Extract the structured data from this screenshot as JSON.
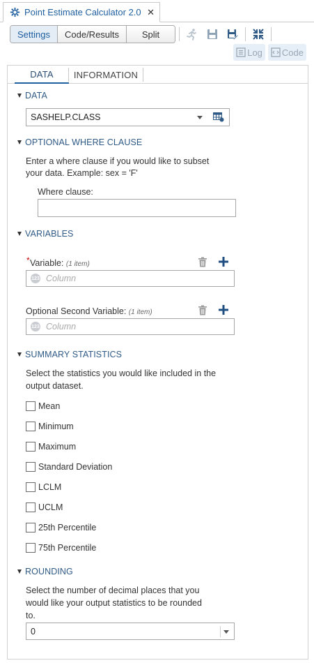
{
  "window": {
    "tab_title": "Point Estimate Calculator 2.0",
    "tab_icon": "gear-cluster-icon",
    "close_glyph": "✕"
  },
  "toolbar": {
    "modes": [
      "Settings",
      "Code/Results",
      "Split"
    ],
    "active_mode": "Settings",
    "icons": [
      "run-icon",
      "save-icon",
      "save-as-icon",
      "collapse-icon"
    ],
    "log_label": "Log",
    "code_label": "Code"
  },
  "subtabs": {
    "items": [
      "DATA",
      "INFORMATION"
    ],
    "active": "DATA"
  },
  "sections": {
    "data": {
      "heading": "DATA",
      "dataset_value": "SASHELP.CLASS"
    },
    "where": {
      "heading": "OPTIONAL WHERE CLAUSE",
      "description_line1": "Enter a where clause if you would like to subset",
      "description_line2": "your data. Example: sex = 'F'",
      "field_label": "Where clause:",
      "field_value": ""
    },
    "variables": {
      "heading": "VARIABLES",
      "required_marker": "*",
      "var1_label": "Variable:",
      "var1_count": "(1 item)",
      "var1_placeholder": "Column",
      "var2_label": "Optional Second Variable:",
      "var2_count": "(1 item)",
      "var2_placeholder": "Column",
      "numeric_badge": "123"
    },
    "summary": {
      "heading": "SUMMARY STATISTICS",
      "description_line1": "Select the statistics you would like included in the",
      "description_line2": "output dataset.",
      "options": [
        "Mean",
        "Minimum",
        "Maximum",
        "Standard Deviation",
        "LCLM",
        "UCLM",
        "25th Percentile",
        "75th Percentile"
      ]
    },
    "rounding": {
      "heading": "ROUNDING",
      "description_line1": "Select the number of decimal places that you",
      "description_line2": "would like your output statistics to be rounded",
      "description_line3": "to.",
      "selected_value": "0"
    }
  },
  "colors": {
    "accent": "#1f5fa0",
    "section_heading": "#2f5a86",
    "required": "#cc0000"
  }
}
